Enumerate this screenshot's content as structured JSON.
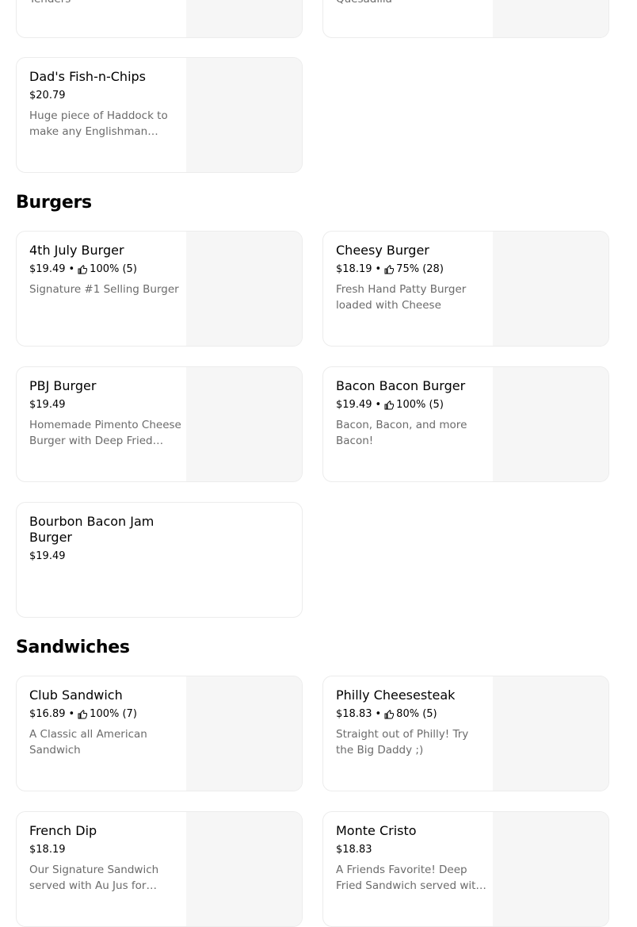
{
  "top_partial": {
    "left_desc_tail": "Tenders",
    "right_desc_tail": "Quesadilla"
  },
  "top_section": {
    "items": [
      {
        "name": "Dad's Fish-n-Chips",
        "price": "$20.79",
        "rating": "",
        "description": "Huge piece of Haddock to make any Englishman Proud!"
      }
    ]
  },
  "burgers": {
    "title": "Burgers",
    "items": [
      {
        "name": "4th July Burger",
        "price": "$19.49",
        "rating": "100% (5)",
        "description": "Signature #1 Selling Burger"
      },
      {
        "name": "Cheesy Burger",
        "price": "$18.19",
        "rating": "75% (28)",
        "description": "Fresh Hand Patty Burger loaded with Cheese"
      },
      {
        "name": "PBJ Burger",
        "price": "$19.49",
        "rating": "",
        "description": "Homemade Pimento Cheese Burger with Deep Fried Jalapenos"
      },
      {
        "name": "Bacon Bacon Burger",
        "price": "$19.49",
        "rating": "100% (5)",
        "description": "Bacon, Bacon, and more Bacon!"
      },
      {
        "name": "Bourbon Bacon Jam Burger",
        "price": "$19.49",
        "rating": "",
        "description": ""
      }
    ]
  },
  "sandwiches": {
    "title": "Sandwiches",
    "items": [
      {
        "name": "Club Sandwich",
        "price": "$16.89",
        "rating": "100% (7)",
        "description": "A Classic all American Sandwich"
      },
      {
        "name": "Philly Cheesesteak",
        "price": "$18.83",
        "rating": "80% (5)",
        "description": "Straight out of Philly! Try the Big Daddy ;)"
      },
      {
        "name": "French Dip",
        "price": "$18.19",
        "rating": "",
        "description": "Our Signature Sandwich served with Au Jus for dipping"
      },
      {
        "name": "Monte Cristo",
        "price": "$18.83",
        "rating": "",
        "description": "A Friends Favorite! Deep Fried Sandwich served with raspberry jam"
      }
    ]
  },
  "separator": "•",
  "icons": {
    "rating": "thumbs-up-icon"
  }
}
